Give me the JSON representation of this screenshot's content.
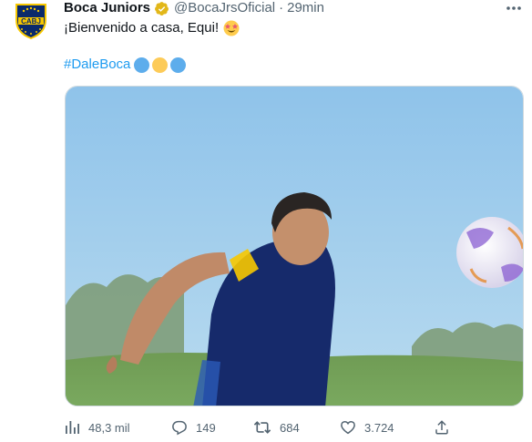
{
  "author": {
    "display_name": "Boca Juniors",
    "handle": "@BocaJrsOficial",
    "separator": "·",
    "time": "29min",
    "verified": true,
    "avatar_text": "CABJ"
  },
  "tweet": {
    "text": "¡Bienvenido a casa, Equi!",
    "emoji": "star-struck-emoji",
    "hashtag": "#DaleBoca",
    "circle_emojis": [
      "blue-circle",
      "yellow-circle",
      "blue-circle"
    ],
    "circle_colors": [
      "#5dadec",
      "#fdcb58",
      "#5dadec"
    ]
  },
  "media": {
    "description_icon": "photo"
  },
  "actions": {
    "views": {
      "icon": "views-icon",
      "count": "48,3 mil"
    },
    "replies": {
      "icon": "reply-icon",
      "count": "149"
    },
    "retweets": {
      "icon": "retweet-icon",
      "count": "684"
    },
    "likes": {
      "icon": "heart-icon",
      "count": "3.724"
    },
    "share": {
      "icon": "share-icon"
    }
  },
  "colors": {
    "text": "#0f1419",
    "secondary": "#536471",
    "accent": "#1d9bf0",
    "verified_gold": "#e2b719",
    "boca_blue": "#0a2a6b",
    "boca_yellow": "#f7c800"
  }
}
